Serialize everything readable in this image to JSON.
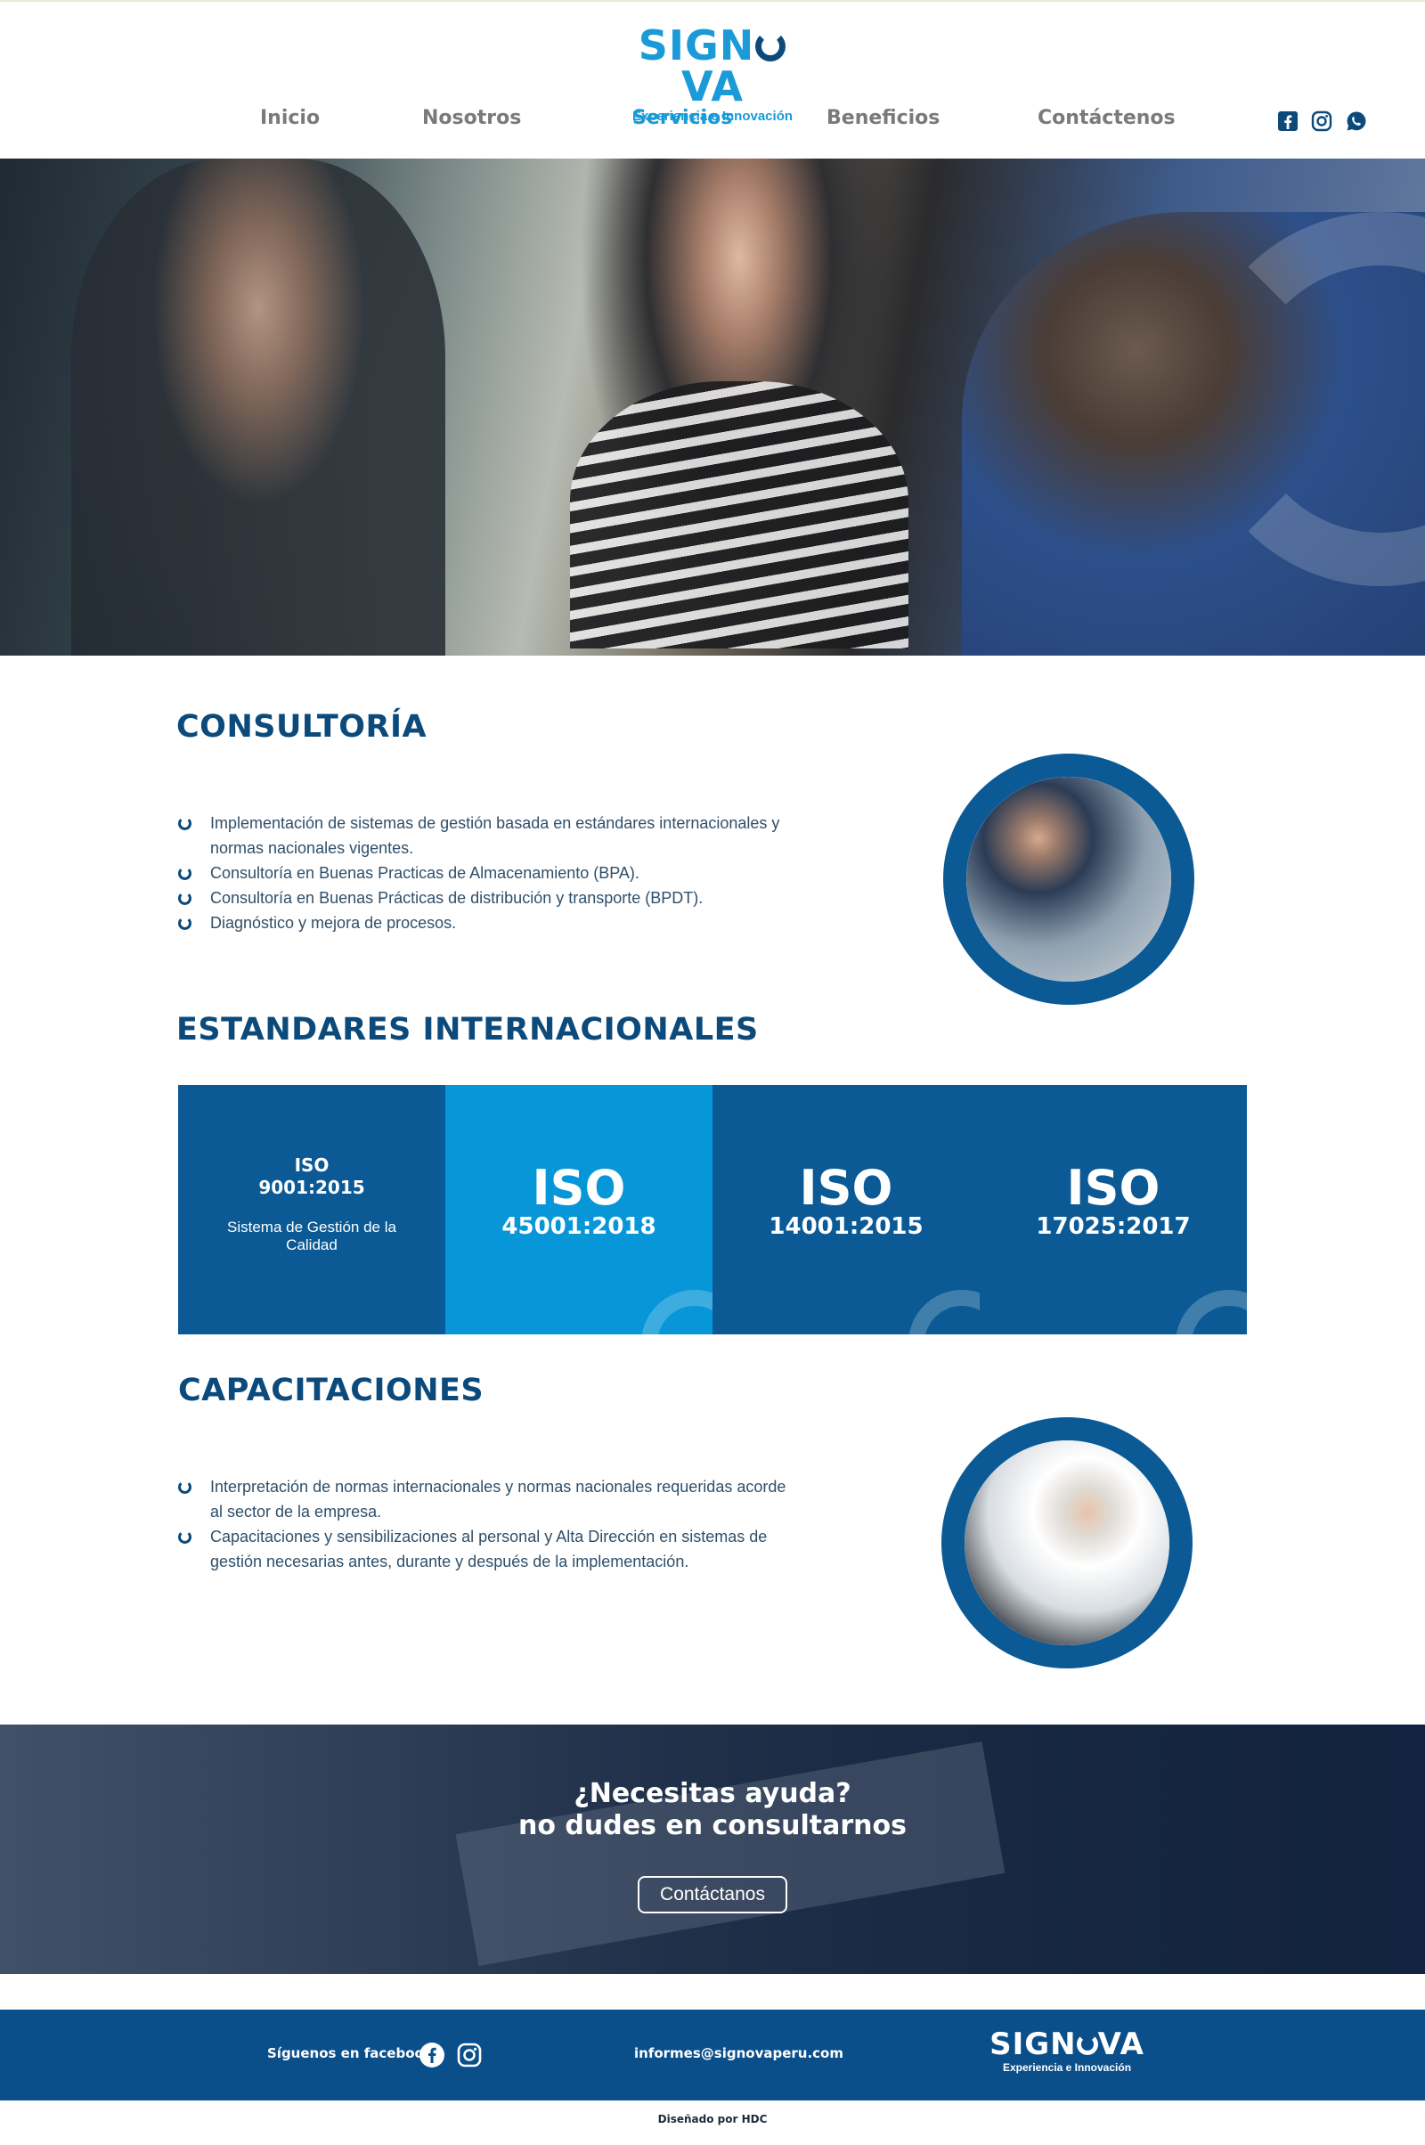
{
  "brand": {
    "name_pre": "SIGN",
    "name_post": "VA",
    "tagline": "Experiencia e Innovación"
  },
  "nav": {
    "items": [
      {
        "label": "Inicio"
      },
      {
        "label": "Nosotros"
      },
      {
        "label": "Servicios",
        "active": true
      },
      {
        "label": "Beneficios"
      },
      {
        "label": "Contáctenos"
      }
    ]
  },
  "social_icons": [
    "facebook-icon",
    "instagram-icon",
    "whatsapp-icon"
  ],
  "consultoria": {
    "title": "CONSULTORÍA",
    "items": [
      "Implementación de sistemas de gestión basada en estándares internacionales y normas nacionales vigentes.",
      "Consultoría en Buenas Practicas de Almacenamiento (BPA).",
      "Consultoría en Buenas Prácticas de distribución y transporte (BPDT).",
      "Diagnóstico y mejora de procesos."
    ]
  },
  "estandares": {
    "title": "ESTANDARES INTERNACIONALES",
    "cells": [
      {
        "line1": "ISO",
        "line2": "9001:2015",
        "desc": "Sistema de Gestión de la Calidad",
        "color": "#0b5a95"
      },
      {
        "big": "ISO",
        "num": "45001:2018",
        "color": "#0797d8"
      },
      {
        "big": "ISO",
        "num": "14001:2015",
        "color": "#0b5a95"
      },
      {
        "big": "ISO",
        "num": "17025:2017",
        "color": "#0b5a95"
      }
    ]
  },
  "capacitaciones": {
    "title": "CAPACITACIONES",
    "items": [
      "Interpretación de normas internacionales y normas nacionales requeridas acorde al sector de la empresa.",
      "Capacitaciones y sensibilizaciones al personal y Alta Dirección en sistemas de gestión necesarias antes, durante y después de la implementación."
    ]
  },
  "cta": {
    "line1": "¿Necesitas ayuda?",
    "line2": "no dudes en consultarnos",
    "button": "Contáctanos"
  },
  "footer": {
    "follow": "Síguenos en facebook",
    "email": "informes@signovaperu.com",
    "credit": "Diseñado por HDC"
  },
  "colors": {
    "primary": "#0b4a7a",
    "accent": "#1a9ad6",
    "iso_light": "#0797d8",
    "footer_bg": "#0b4f8a"
  }
}
